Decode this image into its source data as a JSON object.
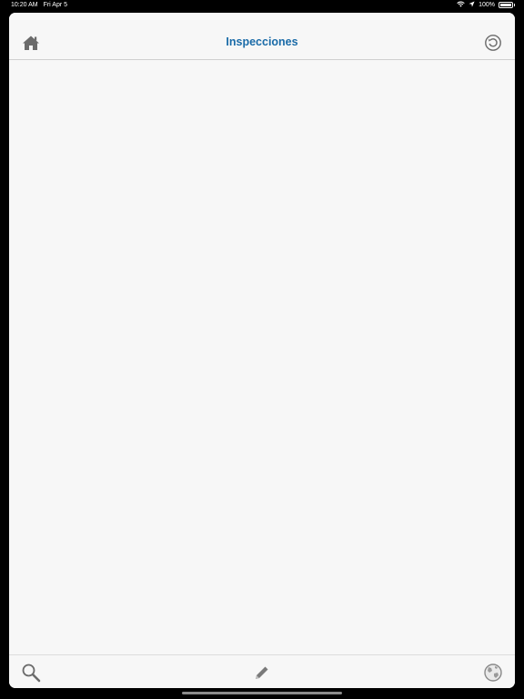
{
  "status_bar": {
    "time": "10:20 AM",
    "date": "Fri Apr 5",
    "battery_percent": "100%",
    "icons": [
      "wifi-icon",
      "location-arrow-icon",
      "battery-icon"
    ]
  },
  "nav": {
    "title": "Inspecciones",
    "left_icon": "home-icon",
    "right_icon": "history-icon"
  },
  "tab_bar": {
    "items": [
      "search-icon",
      "pencil-icon",
      "globe-icon"
    ]
  },
  "colors": {
    "accent": "#1a6ba8",
    "icon": "#6b6b6b",
    "background": "#f7f7f7"
  }
}
